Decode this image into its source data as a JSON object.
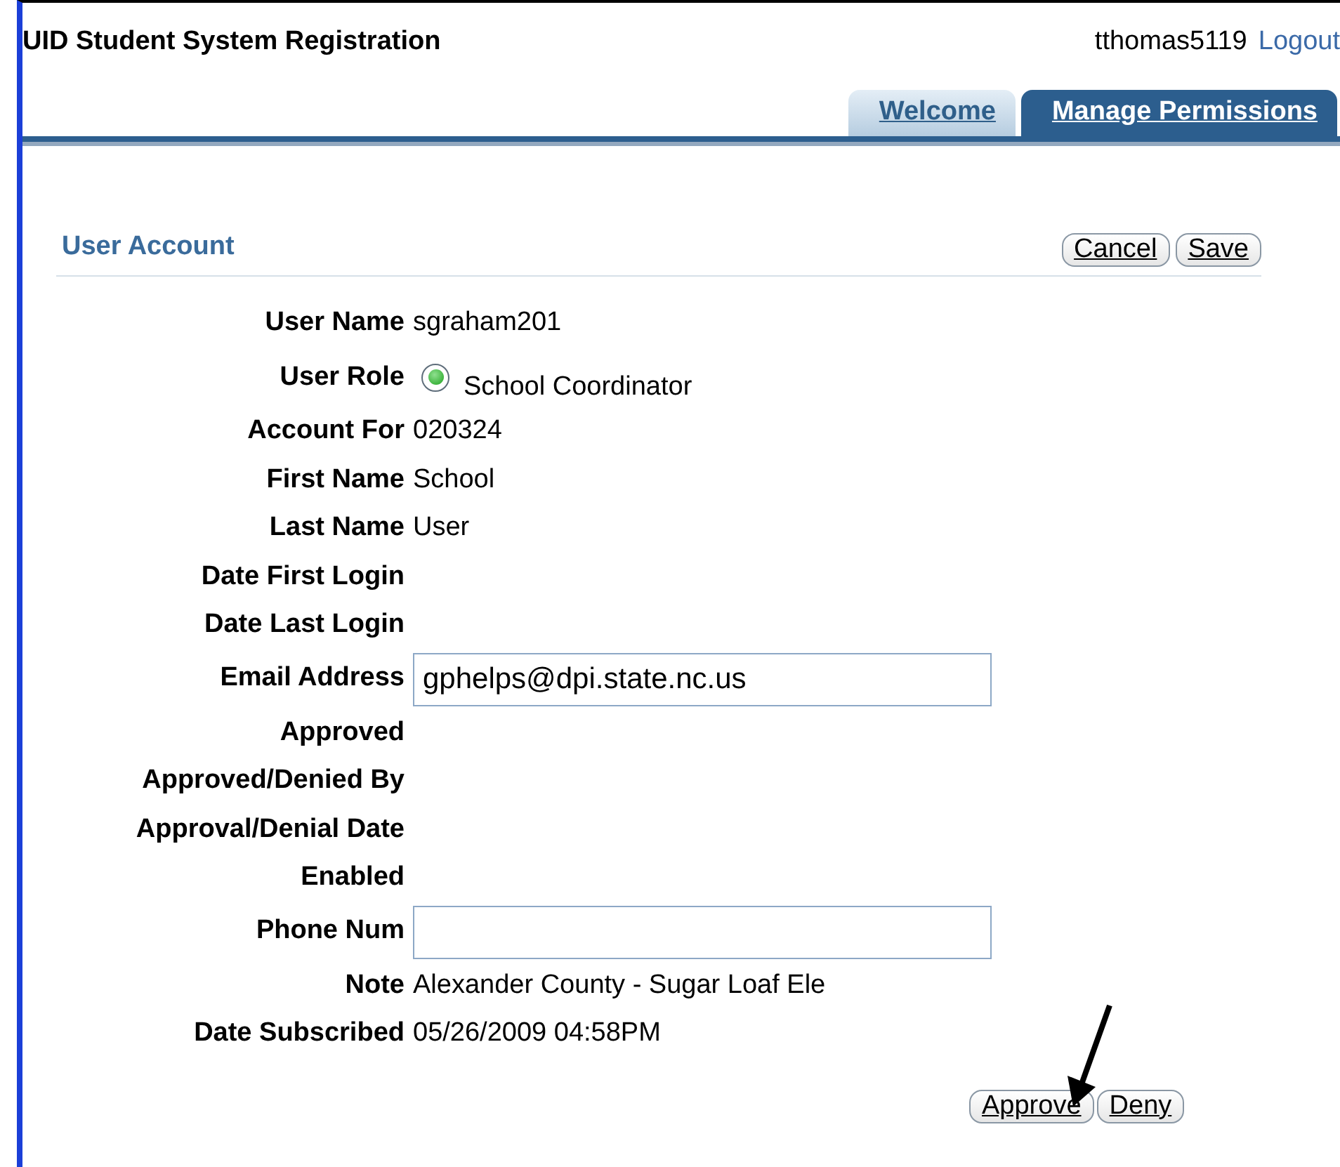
{
  "header": {
    "title": "UID Student System Registration",
    "user": "tthomas5119",
    "logout": "Logout"
  },
  "tabs": [
    {
      "label": "Welcome",
      "selected": false
    },
    {
      "label": "Manage Permissions",
      "selected": true
    }
  ],
  "section": {
    "title": "User Account",
    "buttons": [
      "Cancel",
      "Save"
    ]
  },
  "fields": [
    {
      "label": "User Name",
      "kind": "text",
      "value": "sgraham201"
    },
    {
      "label": "User Role",
      "kind": "radio",
      "value": "School Coordinator",
      "selected": true
    },
    {
      "label": "Account For",
      "kind": "text",
      "value": "020324"
    },
    {
      "label": "First Name",
      "kind": "text",
      "value": "School"
    },
    {
      "label": "Last Name",
      "kind": "text",
      "value": "User"
    },
    {
      "label": "Date First Login",
      "kind": "text"
    },
    {
      "label": "Date Last Login",
      "kind": "text"
    },
    {
      "label": "Email Address",
      "kind": "input",
      "value": "gphelps@dpi.state.nc.us"
    },
    {
      "label": "Approved",
      "kind": "text"
    },
    {
      "label": "Approved/Denied By",
      "kind": "text"
    },
    {
      "label": "Approval/Denial Date",
      "kind": "text"
    },
    {
      "label": "Enabled",
      "kind": "text"
    },
    {
      "label": "Phone Num",
      "kind": "input"
    },
    {
      "label": "Note",
      "kind": "text",
      "value": "Alexander County - Sugar Loaf Ele"
    },
    {
      "label": "Date Subscribed",
      "kind": "text",
      "value": "05/26/2009 04:58PM"
    }
  ],
  "actions": [
    "Approve",
    "Deny"
  ]
}
